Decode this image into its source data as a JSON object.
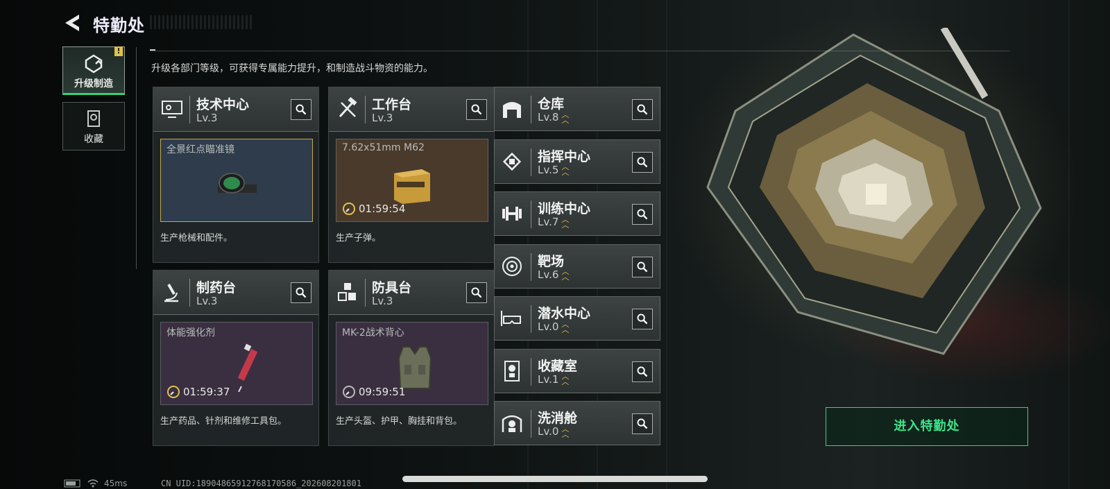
{
  "header": {
    "title": "特勤处"
  },
  "tabs": [
    {
      "label": "升级制造",
      "active": true,
      "alert": "!"
    },
    {
      "label": "收藏",
      "active": false
    }
  ],
  "description": "升级各部门等级，可获得专属能力提升，和制造战斗物资的能力。",
  "cards": [
    {
      "name": "技术中心",
      "level": "Lv.3",
      "icon": "monitor-icon",
      "product": "全景红点瞄准镜",
      "timer": "",
      "desc": "生产枪械和配件。",
      "bg": "#2e3c4c",
      "border": "#c9a94b"
    },
    {
      "name": "工作台",
      "level": "Lv.3",
      "icon": "tools-icon",
      "product": "7.62x51mm M62",
      "timer": "01:59:54",
      "desc": "生产子弹。",
      "bg": "#4a3a2c"
    },
    {
      "name": "制药台",
      "level": "Lv.3",
      "icon": "microscope-icon",
      "product": "体能强化剂",
      "timer": "01:59:37",
      "desc": "生产药品、针剂和维修工具包。",
      "bg": "#3a2f40"
    },
    {
      "name": "防具台",
      "level": "Lv.3",
      "icon": "blocks-icon",
      "product": "MK-2战术背心",
      "timer": "09:59:51",
      "desc": "生产头盔、护甲、胸挂和背包。",
      "bg": "#3a2f40"
    }
  ],
  "facilities": [
    {
      "name": "仓库",
      "level": "Lv.8",
      "icon": "warehouse-icon"
    },
    {
      "name": "指挥中心",
      "level": "Lv.5",
      "icon": "chip-icon"
    },
    {
      "name": "训练中心",
      "level": "Lv.7",
      "icon": "dumbbell-icon"
    },
    {
      "name": "靶场",
      "level": "Lv.6",
      "icon": "target-icon"
    },
    {
      "name": "潜水中心",
      "level": "Lv.0",
      "icon": "diving-mask-icon"
    },
    {
      "name": "收藏室",
      "level": "Lv.1",
      "icon": "trophy-case-icon"
    },
    {
      "name": "洗消舱",
      "level": "Lv.0",
      "icon": "decon-icon"
    }
  ],
  "enter_button": "进入特勤处",
  "status": {
    "ping": "45ms",
    "uid": "CN UID:18904865912768170586_202608201801"
  },
  "colors": {
    "accent": "#3ee38b",
    "upgrade": "#e2c24c"
  }
}
